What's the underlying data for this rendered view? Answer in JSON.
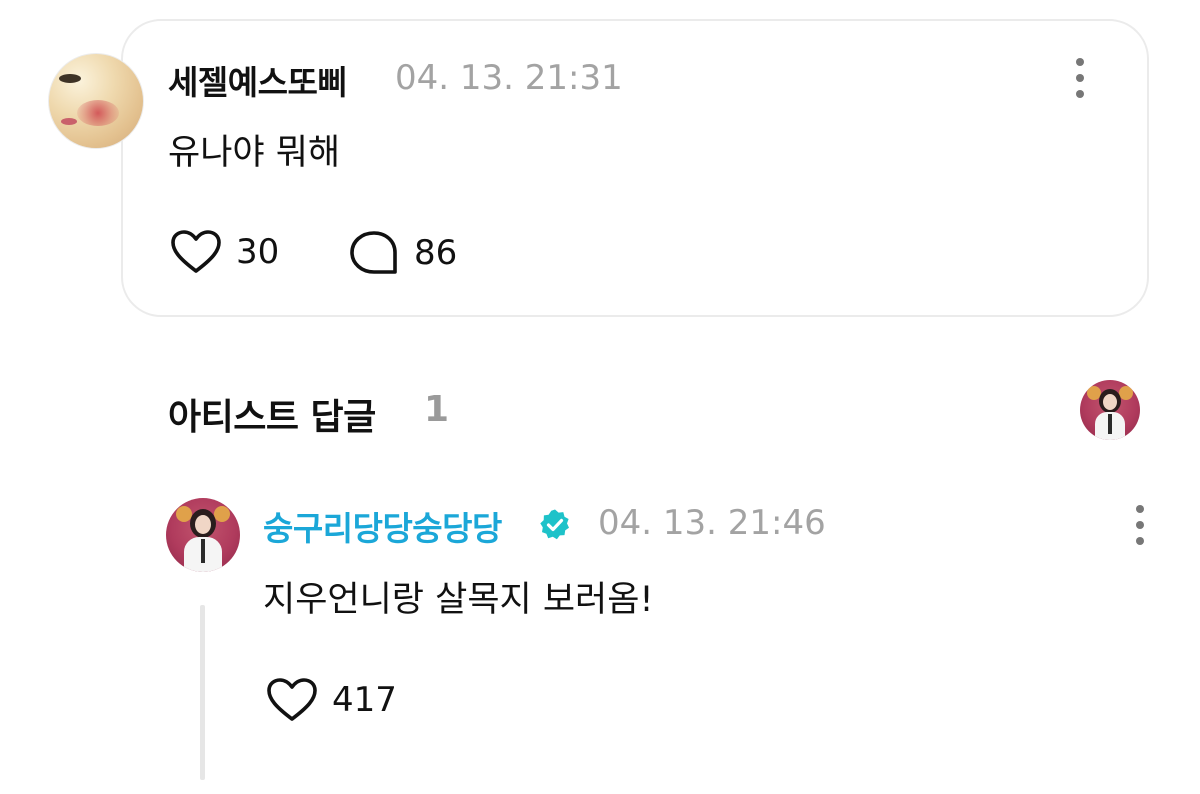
{
  "comment": {
    "author": "세젤예스또삐",
    "timestamp": "04. 13. 21:31",
    "text": "유나야 뭐해",
    "like_count": "30",
    "reply_count": "86"
  },
  "artist_replies": {
    "title": "아티스트 답글",
    "count": "1"
  },
  "reply": {
    "author": "숭구리당당숭당당",
    "verified": true,
    "timestamp": "04. 13. 21:46",
    "text": "지우언니랑 살목지 보러옴!",
    "like_count": "417"
  },
  "icons": {
    "like": "heart-outline-icon",
    "reply": "speech-bubble-icon",
    "more": "more-vertical-icon",
    "verified": "verified-badge-icon"
  },
  "colors": {
    "artist_name": "#1ba7d8",
    "verified_badge": "#1ec2c9",
    "timestamp": "#a3a3a3",
    "card_border": "#ebebeb"
  }
}
